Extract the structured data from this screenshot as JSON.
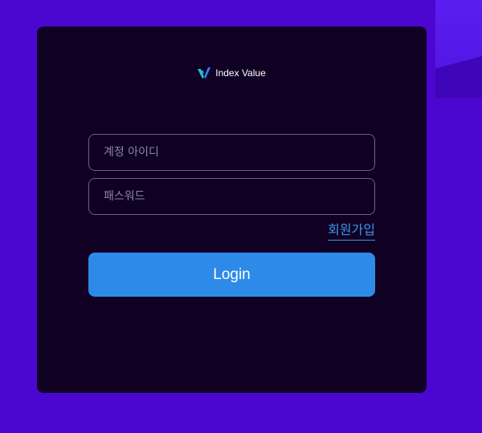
{
  "brand": {
    "name": "Index Value",
    "icon": "index-value-logo-icon",
    "icon_colors": [
      "#1fc8d8",
      "#3a7bf0"
    ]
  },
  "form": {
    "id_placeholder": "계정 아이디",
    "password_placeholder": "패스워드",
    "signup_label": "회원가입",
    "login_label": "Login"
  },
  "colors": {
    "background": "#4b07d0",
    "card": "#0f0024",
    "accent": "#2e8ae8",
    "link": "#3d95ec"
  }
}
